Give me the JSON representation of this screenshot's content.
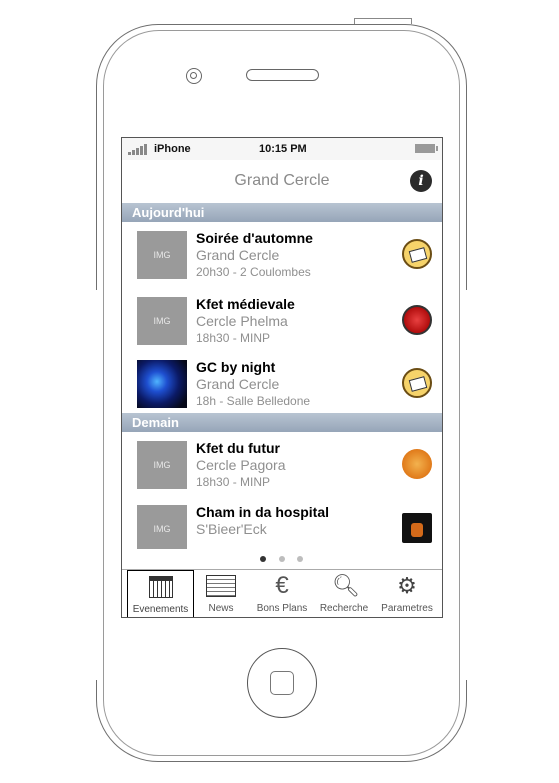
{
  "status_bar": {
    "carrier": "iPhone",
    "time": "10:15 PM"
  },
  "nav": {
    "title": "Grand Cercle"
  },
  "sections": [
    {
      "header": "Aujourd'hui",
      "events": [
        {
          "title": "Soirée d'automne",
          "venue": "Grand Cercle",
          "details": "20h30 - 2 Coulombes",
          "image_placeholder": "IMG",
          "logo": "grand-cercle-logo-icon"
        },
        {
          "title": "Kfet médievale",
          "venue": "Cercle Phelma",
          "details": "18h30 - MINP",
          "image_placeholder": "IMG",
          "logo": "phelma-logo-icon"
        },
        {
          "title": "GC by night",
          "venue": "Grand Cercle",
          "details": "18h - Salle Belledone",
          "image_placeholder": "",
          "logo": "grand-cercle-logo-icon"
        }
      ]
    },
    {
      "header": "Demain",
      "events": [
        {
          "title": "Kfet du futur",
          "venue": "Cercle Pagora",
          "details": "18h30 - MINP",
          "image_placeholder": "IMG",
          "logo": "pagora-logo-icon"
        },
        {
          "title": "Cham in da hospital",
          "venue": "S'Bieer'Eck",
          "details": "",
          "image_placeholder": "IMG",
          "logo": "sbieereck-logo-icon"
        }
      ]
    }
  ],
  "pager": {
    "total": 3,
    "active": 1
  },
  "tabs": [
    {
      "label": "Evenements",
      "icon": "calendar-icon",
      "selected": true
    },
    {
      "label": "News",
      "icon": "newspaper-icon",
      "selected": false
    },
    {
      "label": "Bons Plans",
      "icon": "euro-icon",
      "selected": false
    },
    {
      "label": "Recherche",
      "icon": "search-icon",
      "selected": false
    },
    {
      "label": "Parametres",
      "icon": "gear-icon",
      "selected": false
    }
  ]
}
